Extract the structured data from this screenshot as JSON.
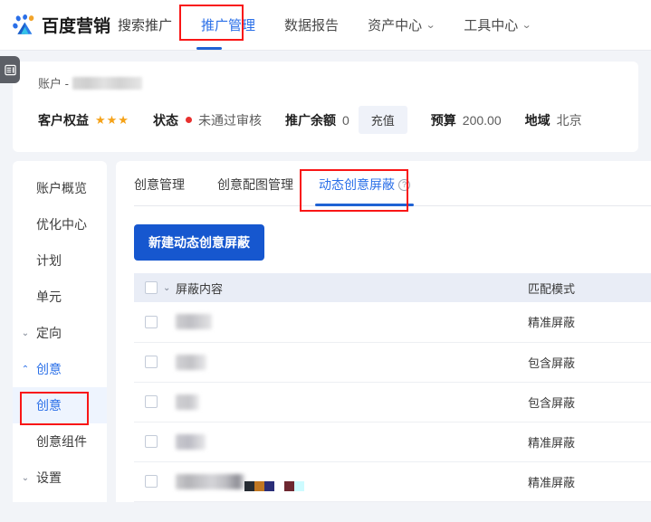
{
  "topnav": {
    "brand_name": "百度营销",
    "brand_sub": "搜索推广",
    "logo_icon": "baidu-paw-logo",
    "items": [
      {
        "label": "推广管理",
        "active": true,
        "has_caret": false
      },
      {
        "label": "数据报告",
        "active": false,
        "has_caret": false
      },
      {
        "label": "资产中心",
        "active": false,
        "has_caret": true
      },
      {
        "label": "工具中心",
        "active": false,
        "has_caret": true
      }
    ],
    "caret_glyph": "⌄"
  },
  "account": {
    "collapse_icon": "panel-collapse-icon",
    "account_label": "账户 -",
    "account_value_masked": "",
    "fields": [
      {
        "name": "rights",
        "label": "客户权益",
        "value": "★★★",
        "type": "stars"
      },
      {
        "name": "status",
        "label": "状态",
        "value": "未通过审核",
        "type": "status"
      },
      {
        "name": "balance",
        "label": "推广余额",
        "value": "0",
        "type": "text"
      },
      {
        "name": "budget",
        "label": "预算",
        "value": "200.00",
        "type": "text"
      },
      {
        "name": "region",
        "label": "地域",
        "value": "北京",
        "type": "text"
      }
    ],
    "recharge_label": "充值",
    "status_dot_color": "#e8302e",
    "star_color": "#f5a218"
  },
  "sidebar": {
    "items": [
      {
        "label": "账户概览",
        "type": "link",
        "state": "normal"
      },
      {
        "label": "优化中心",
        "type": "link",
        "state": "normal"
      },
      {
        "label": "计划",
        "type": "link",
        "state": "normal"
      },
      {
        "label": "单元",
        "type": "link",
        "state": "normal"
      },
      {
        "label": "定向",
        "type": "group",
        "state": "collapsed",
        "chevron": "⌄"
      },
      {
        "label": "创意",
        "type": "group",
        "state": "expanded",
        "chevron": "⌃"
      },
      {
        "label": "创意",
        "type": "sub",
        "state": "selected"
      },
      {
        "label": "创意组件",
        "type": "sub",
        "state": "normal"
      },
      {
        "label": "设置",
        "type": "group",
        "state": "collapsed",
        "chevron": "⌄"
      }
    ]
  },
  "content": {
    "tabs": [
      {
        "label": "创意管理",
        "active": false,
        "help": false
      },
      {
        "label": "创意配图管理",
        "active": false,
        "help": false
      },
      {
        "label": "动态创意屏蔽",
        "active": true,
        "help": true
      }
    ],
    "help_glyph": "?",
    "new_button_label": "新建动态创意屏蔽",
    "table": {
      "header_chevron": "⌄",
      "columns": [
        "屏蔽内容",
        "匹配模式"
      ],
      "rows": [
        {
          "content_masked": "",
          "mask_style": "mask-a",
          "mode": "精准屏蔽"
        },
        {
          "content_masked": "",
          "mask_style": "mask-b",
          "mode": "包含屏蔽"
        },
        {
          "content_masked": "",
          "mask_style": "mask-c",
          "mode": "包含屏蔽"
        },
        {
          "content_masked": "",
          "mask_style": "mask-d",
          "mode": "精准屏蔽"
        },
        {
          "content_masked": "",
          "mask_style": "mask-e",
          "mode": "精准屏蔽"
        }
      ]
    }
  },
  "annotations": {
    "nav_box": "推广管理",
    "tab_box": "动态创意屏蔽",
    "sidebar_box": "创意",
    "color": "#f91616"
  },
  "colors": {
    "accent": "#2a6fe8",
    "primary_button": "#1657cf",
    "page_bg": "#f2f4f8",
    "table_header_bg": "#e9edf6",
    "selected_bg": "#eef4fe"
  }
}
